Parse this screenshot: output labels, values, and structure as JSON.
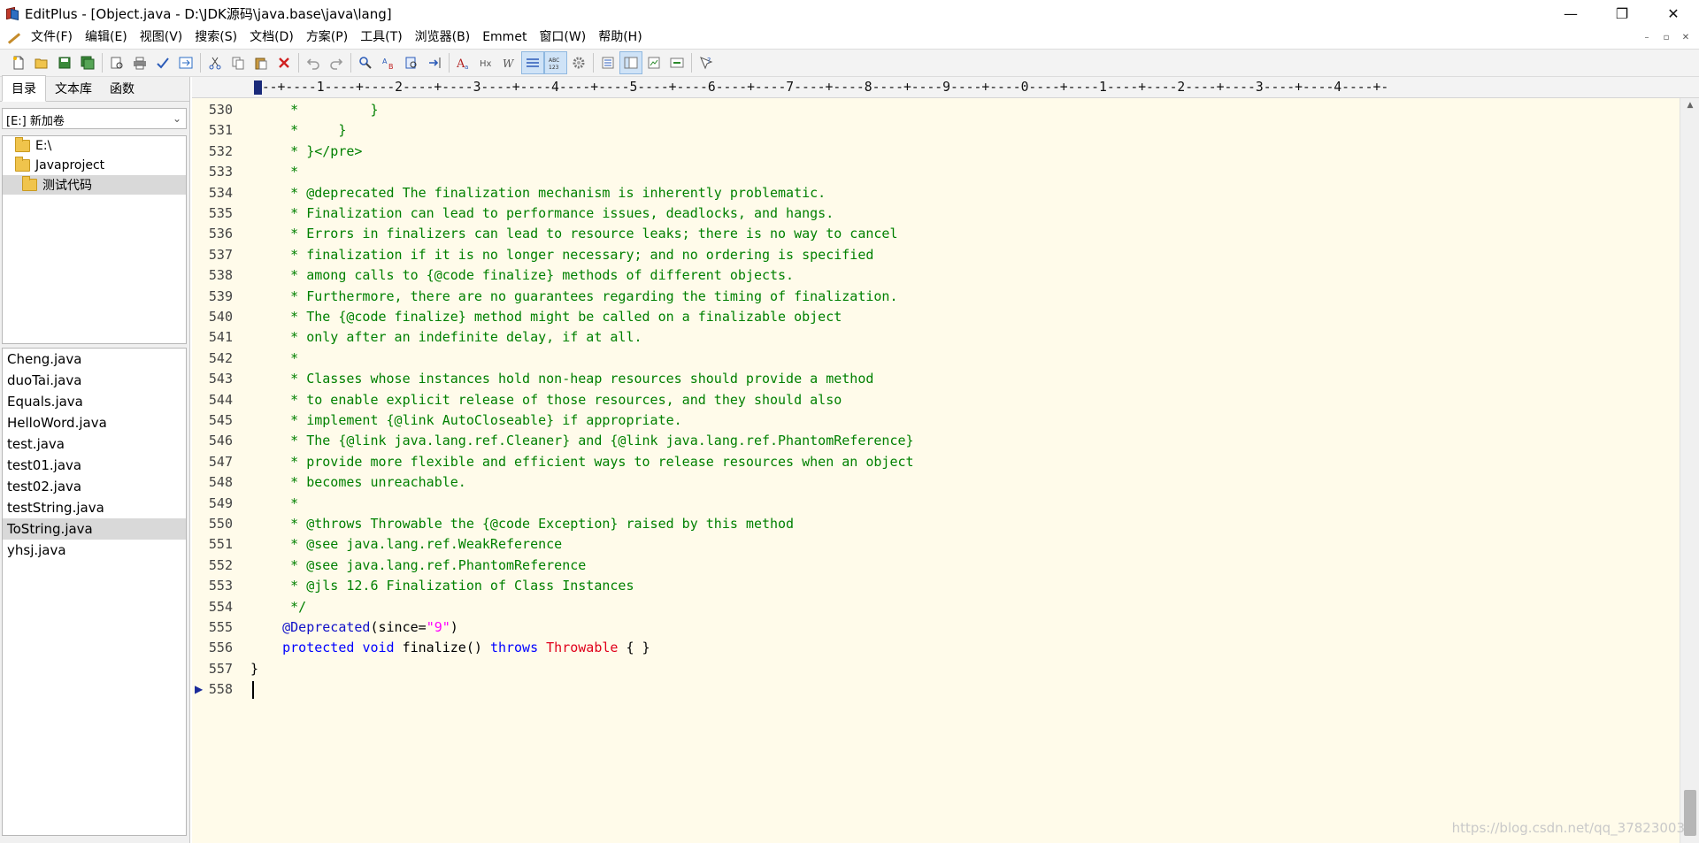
{
  "window": {
    "title": "EditPlus - [Object.java - D:\\JDK源码\\java.base\\java\\lang]",
    "controls": {
      "minimize": "—",
      "maximize": "❐",
      "close": "✕"
    }
  },
  "menu": {
    "items": [
      "文件(F)",
      "编辑(E)",
      "视图(V)",
      "搜索(S)",
      "文档(D)",
      "方案(P)",
      "工具(T)",
      "浏览器(B)",
      "Emmet",
      "窗口(W)",
      "帮助(H)"
    ],
    "mdi_controls": {
      "minimize": "–",
      "restore": "▫",
      "close": "✕"
    }
  },
  "toolbar": {
    "buttons": [
      "new-file",
      "open-file",
      "save",
      "save-all",
      "print-preview",
      "print",
      "spell-check",
      "browser-preview",
      "cut",
      "copy",
      "paste",
      "delete",
      "undo",
      "redo",
      "find",
      "replace",
      "find-in-files",
      "goto",
      "font",
      "hex",
      "word-wrap",
      "line-number",
      "column-select",
      "settings",
      "document-list",
      "output-window",
      "cliptext",
      "user-tool",
      "help"
    ],
    "active": [
      "line-number",
      "column-select"
    ]
  },
  "left_panel": {
    "tabs": [
      "目录",
      "文本库",
      "函数"
    ],
    "active_tab": "目录",
    "drive": "[E:] 新加卷",
    "tree": [
      {
        "label": "E:\\",
        "indent": 1
      },
      {
        "label": "Javaproject",
        "indent": 1
      },
      {
        "label": "测试代码",
        "indent": 2,
        "selected": true
      }
    ],
    "files": [
      "Cheng.java",
      "duoTai.java",
      "Equals.java",
      "HelloWord.java",
      "test.java",
      "test01.java",
      "test02.java",
      "testString.java",
      "ToString.java",
      "yhsj.java"
    ],
    "selected_file": "ToString.java"
  },
  "editor": {
    "ruler": "---+----1----+----2----+----3----+----4----+----5----+----6----+----7----+----8----+----9----+----0----+----1----+----2----+----3----+----4----+-",
    "current_line": "558",
    "lines": [
      {
        "no": "530",
        "segs": [
          {
            "t": "     *         }",
            "c": "comment"
          }
        ]
      },
      {
        "no": "531",
        "segs": [
          {
            "t": "     *     }",
            "c": "comment"
          }
        ]
      },
      {
        "no": "532",
        "segs": [
          {
            "t": "     * }</pre>",
            "c": "comment"
          }
        ]
      },
      {
        "no": "533",
        "segs": [
          {
            "t": "     *",
            "c": "comment"
          }
        ]
      },
      {
        "no": "534",
        "segs": [
          {
            "t": "     * @deprecated The finalization mechanism is inherently problematic.",
            "c": "comment"
          }
        ]
      },
      {
        "no": "535",
        "segs": [
          {
            "t": "     * Finalization can lead to performance issues, deadlocks, and hangs.",
            "c": "comment"
          }
        ]
      },
      {
        "no": "536",
        "segs": [
          {
            "t": "     * Errors in finalizers can lead to resource leaks; there is no way to cancel",
            "c": "comment"
          }
        ]
      },
      {
        "no": "537",
        "segs": [
          {
            "t": "     * finalization if it is no longer necessary; and no ordering is specified",
            "c": "comment"
          }
        ]
      },
      {
        "no": "538",
        "segs": [
          {
            "t": "     * among calls to {@code finalize} methods of different objects.",
            "c": "comment"
          }
        ]
      },
      {
        "no": "539",
        "segs": [
          {
            "t": "     * Furthermore, there are no guarantees regarding the timing of finalization.",
            "c": "comment"
          }
        ]
      },
      {
        "no": "540",
        "segs": [
          {
            "t": "     * The {@code finalize} method might be called on a finalizable object",
            "c": "comment"
          }
        ]
      },
      {
        "no": "541",
        "segs": [
          {
            "t": "     * only after an indefinite delay, if at all.",
            "c": "comment"
          }
        ]
      },
      {
        "no": "542",
        "segs": [
          {
            "t": "     *",
            "c": "comment"
          }
        ]
      },
      {
        "no": "543",
        "segs": [
          {
            "t": "     * Classes whose instances hold non-heap resources should provide a method",
            "c": "comment"
          }
        ]
      },
      {
        "no": "544",
        "segs": [
          {
            "t": "     * to enable explicit release of those resources, and they should also",
            "c": "comment"
          }
        ]
      },
      {
        "no": "545",
        "segs": [
          {
            "t": "     * implement {@link AutoCloseable} if appropriate.",
            "c": "comment"
          }
        ]
      },
      {
        "no": "546",
        "segs": [
          {
            "t": "     * The {@link java.lang.ref.Cleaner} and {@link java.lang.ref.PhantomReference}",
            "c": "comment"
          }
        ]
      },
      {
        "no": "547",
        "segs": [
          {
            "t": "     * provide more flexible and efficient ways to release resources when an object",
            "c": "comment"
          }
        ]
      },
      {
        "no": "548",
        "segs": [
          {
            "t": "     * becomes unreachable.",
            "c": "comment"
          }
        ]
      },
      {
        "no": "549",
        "segs": [
          {
            "t": "     *",
            "c": "comment"
          }
        ]
      },
      {
        "no": "550",
        "segs": [
          {
            "t": "     * @throws Throwable the {@code Exception} raised by this method",
            "c": "comment"
          }
        ]
      },
      {
        "no": "551",
        "segs": [
          {
            "t": "     * @see java.lang.ref.WeakReference",
            "c": "comment"
          }
        ]
      },
      {
        "no": "552",
        "segs": [
          {
            "t": "     * @see java.lang.ref.PhantomReference",
            "c": "comment"
          }
        ]
      },
      {
        "no": "553",
        "segs": [
          {
            "t": "     * @jls 12.6 Finalization of Class Instances",
            "c": "comment"
          }
        ]
      },
      {
        "no": "554",
        "segs": [
          {
            "t": "     */",
            "c": "comment"
          }
        ]
      },
      {
        "no": "555",
        "segs": [
          {
            "t": "    ",
            "c": "plain"
          },
          {
            "t": "@Deprecated",
            "c": "anno"
          },
          {
            "t": "(since=",
            "c": "plain"
          },
          {
            "t": "\"9\"",
            "c": "str"
          },
          {
            "t": ")",
            "c": "plain"
          }
        ]
      },
      {
        "no": "556",
        "segs": [
          {
            "t": "    ",
            "c": "plain"
          },
          {
            "t": "protected",
            "c": "kw"
          },
          {
            "t": " ",
            "c": "plain"
          },
          {
            "t": "void",
            "c": "kw"
          },
          {
            "t": " finalize() ",
            "c": "plain"
          },
          {
            "t": "throws",
            "c": "kw"
          },
          {
            "t": " ",
            "c": "plain"
          },
          {
            "t": "Throwable",
            "c": "type"
          },
          {
            "t": " { }",
            "c": "plain"
          }
        ]
      },
      {
        "no": "557",
        "segs": [
          {
            "t": "}",
            "c": "plain"
          }
        ]
      },
      {
        "no": "558",
        "segs": [
          {
            "t": "",
            "c": "plain"
          }
        ]
      }
    ]
  },
  "watermark": "https://blog.csdn.net/qq_37823003",
  "colors": {
    "editor_bg": "#fffbea",
    "comment": "#008000",
    "keyword": "#0000ff",
    "annotation": "#1010c8",
    "string": "#ff00ff",
    "type": "#e0001a"
  }
}
